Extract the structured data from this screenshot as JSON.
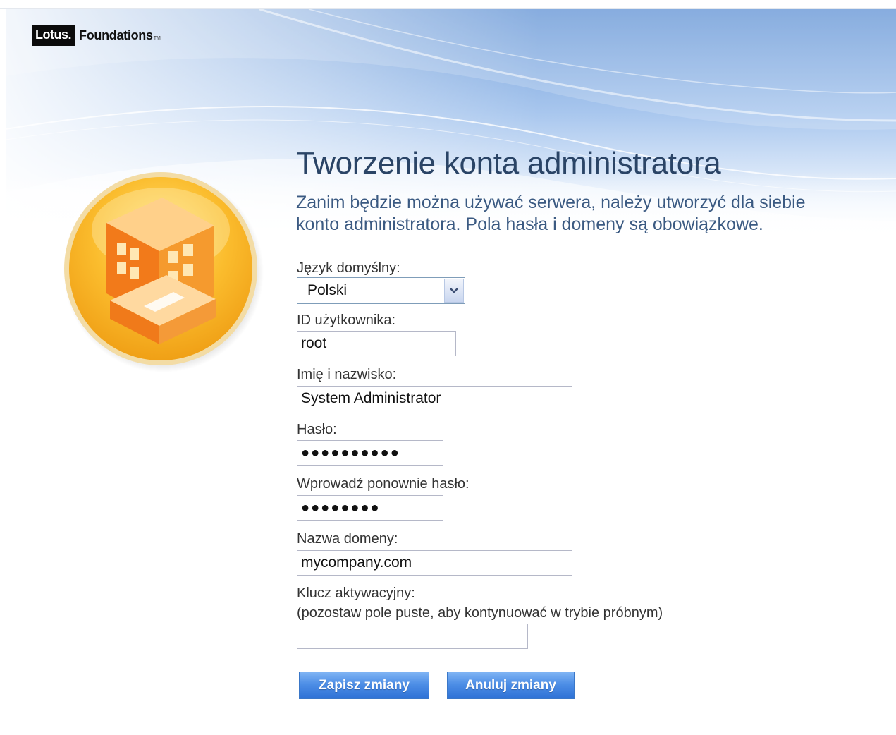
{
  "brand": {
    "logo_box": "Lotus.",
    "logo_text": "Foundations",
    "logo_tm": "TM"
  },
  "page": {
    "title": "Tworzenie konta administratora",
    "intro_line1": "Zanim będzie można używać serwera, należy utworzyć dla siebie",
    "intro_line2": "konto administratora. Pola hasła i domeny są obowiązkowe."
  },
  "form": {
    "language_label": "Język domyślny:",
    "language_value": "Polski",
    "user_id_label": "ID użytkownika:",
    "user_id_value": "root",
    "full_name_label": "Imię i nazwisko:",
    "full_name_value": "System Administrator",
    "password_label": "Hasło:",
    "password_value": "●●●●●●●●●●",
    "password_confirm_label": "Wprowadź ponownie hasło:",
    "password_confirm_value": "●●●●●●●●",
    "domain_label": "Nazwa domeny:",
    "domain_value": "mycompany.com",
    "activation_label": "Klucz aktywacyjny:",
    "activation_hint": "(pozostaw pole puste, aby kontynuować w trybie próbnym)",
    "activation_value": ""
  },
  "buttons": {
    "save": "Zapisz zmiany",
    "cancel": "Anuluj zmiany"
  },
  "icons": {
    "dropdown": "chevron-down-icon",
    "emblem": "building-icon"
  },
  "colors": {
    "title": "#2a4466",
    "intro": "#3b5a82",
    "button": "#3f83e0",
    "emblem": "#f5a623",
    "building": "#f07a1a"
  }
}
